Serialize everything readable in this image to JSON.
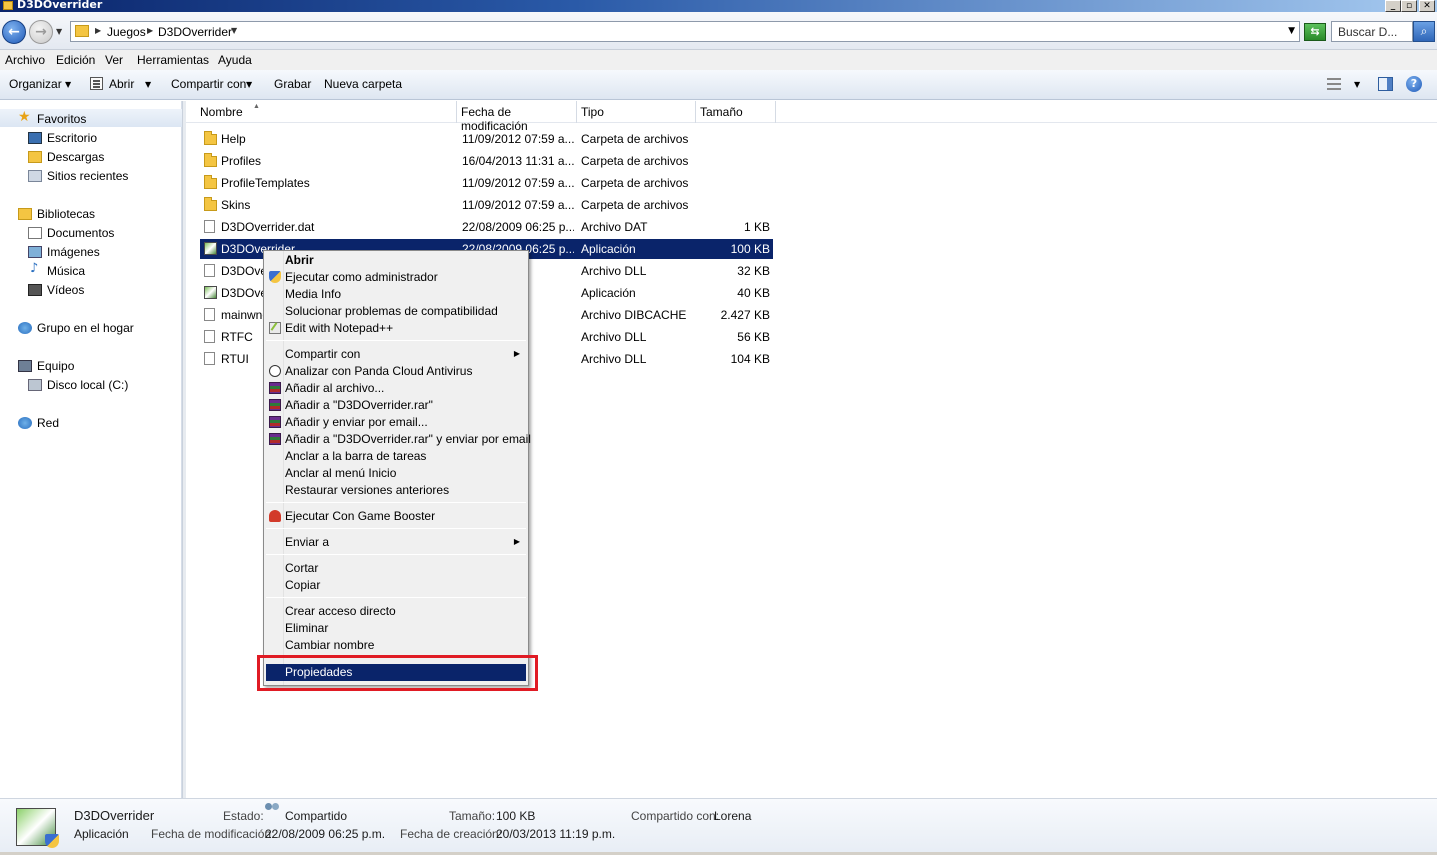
{
  "window": {
    "title": "D3DOverrider",
    "min": "_",
    "max": "▫",
    "close": "✕"
  },
  "address": {
    "crumbs": [
      "Juegos",
      "D3DOverrider"
    ],
    "search_placeholder": "Buscar D..."
  },
  "menubar": [
    "Archivo",
    "Edición",
    "Ver",
    "Herramientas",
    "Ayuda"
  ],
  "toolbar": {
    "organize": "Organizar",
    "open": "Abrir",
    "share": "Compartir con",
    "burn": "Grabar",
    "new_folder": "Nueva carpeta"
  },
  "navpane": {
    "favorites": "Favoritos",
    "fav_items": [
      "Escritorio",
      "Descargas",
      "Sitios recientes"
    ],
    "libraries": "Bibliotecas",
    "lib_items": [
      "Documentos",
      "Imágenes",
      "Música",
      "Vídeos"
    ],
    "homegroup": "Grupo en el hogar",
    "computer": "Equipo",
    "computer_items": [
      "Disco local (C:)"
    ],
    "network": "Red"
  },
  "columns": {
    "name": "Nombre",
    "date": "Fecha de modificación",
    "type": "Tipo",
    "size": "Tamaño"
  },
  "files": [
    {
      "icon": "folder-icon",
      "name": "Help",
      "date": "11/09/2012 07:59 a...",
      "type": "Carpeta de archivos",
      "size": ""
    },
    {
      "icon": "folder-icon",
      "name": "Profiles",
      "date": "16/04/2013 11:31 a...",
      "type": "Carpeta de archivos",
      "size": ""
    },
    {
      "icon": "folder-icon",
      "name": "ProfileTemplates",
      "date": "11/09/2012 07:59 a...",
      "type": "Carpeta de archivos",
      "size": ""
    },
    {
      "icon": "folder-icon",
      "name": "Skins",
      "date": "11/09/2012 07:59 a...",
      "type": "Carpeta de archivos",
      "size": ""
    },
    {
      "icon": "file-icon",
      "name": "D3DOverrider.dat",
      "date": "22/08/2009 06:25 p...",
      "type": "Archivo DAT",
      "size": "1 KB"
    },
    {
      "icon": "app-icon",
      "name": "D3DOverrider",
      "date": "22/08/2009 06:25 p...",
      "type": "Aplicación",
      "size": "100 KB",
      "selected": true
    },
    {
      "icon": "file-icon",
      "name": "D3DOve",
      "date": "...:25 p...",
      "type": "Archivo DLL",
      "size": "32 KB"
    },
    {
      "icon": "app-icon",
      "name": "D3DOve",
      "date": "...:25 p...",
      "type": "Aplicación",
      "size": "40 KB"
    },
    {
      "icon": "file-icon",
      "name": "mainwnc",
      "date": "...1:31 a...",
      "type": "Archivo DIBCACHE",
      "size": "2.427 KB"
    },
    {
      "icon": "file-icon",
      "name": "RTFC",
      "date": "...:25 p...",
      "type": "Archivo DLL",
      "size": "56 KB"
    },
    {
      "icon": "file-icon",
      "name": "RTUI",
      "date": "...:25 p...",
      "type": "Archivo DLL",
      "size": "104 KB"
    }
  ],
  "context_menu": {
    "open": "Abrir",
    "run_as_admin": "Ejecutar como administrador",
    "media_info": "Media Info",
    "troubleshoot": "Solucionar problemas de compatibilidad",
    "notepad": "Edit with Notepad++",
    "share_with": "Compartir con",
    "panda": "Analizar con Panda Cloud Antivirus",
    "add_archive": "Añadir al archivo...",
    "add_rar": "Añadir a \"D3DOverrider.rar\"",
    "add_email": "Añadir y enviar por email...",
    "add_rar_email": "Añadir a \"D3DOverrider.rar\" y enviar por email",
    "pin_taskbar": "Anclar a la barra de tareas",
    "pin_start": "Anclar al menú Inicio",
    "restore": "Restaurar versiones anteriores",
    "game_booster": "Ejecutar Con Game Booster",
    "send_to": "Enviar a",
    "cut": "Cortar",
    "copy": "Copiar",
    "shortcut": "Crear acceso directo",
    "delete": "Eliminar",
    "rename": "Cambiar nombre",
    "properties": "Propiedades"
  },
  "details": {
    "name": "D3DOverrider",
    "kind": "Aplicación",
    "state_label": "Estado:",
    "state_value": "Compartido",
    "size_label": "Tamaño:",
    "size_value": "100 KB",
    "shared_label": "Compartido con:",
    "shared_value": "Lorena",
    "modified_label": "Fecha de modificación:",
    "modified_value": "22/08/2009 06:25 p.m.",
    "created_label": "Fecha de creación:",
    "created_value": "20/03/2013 11:19 p.m."
  },
  "colors": {
    "selection": "#0a246a",
    "highlight_box": "#e01b24"
  }
}
